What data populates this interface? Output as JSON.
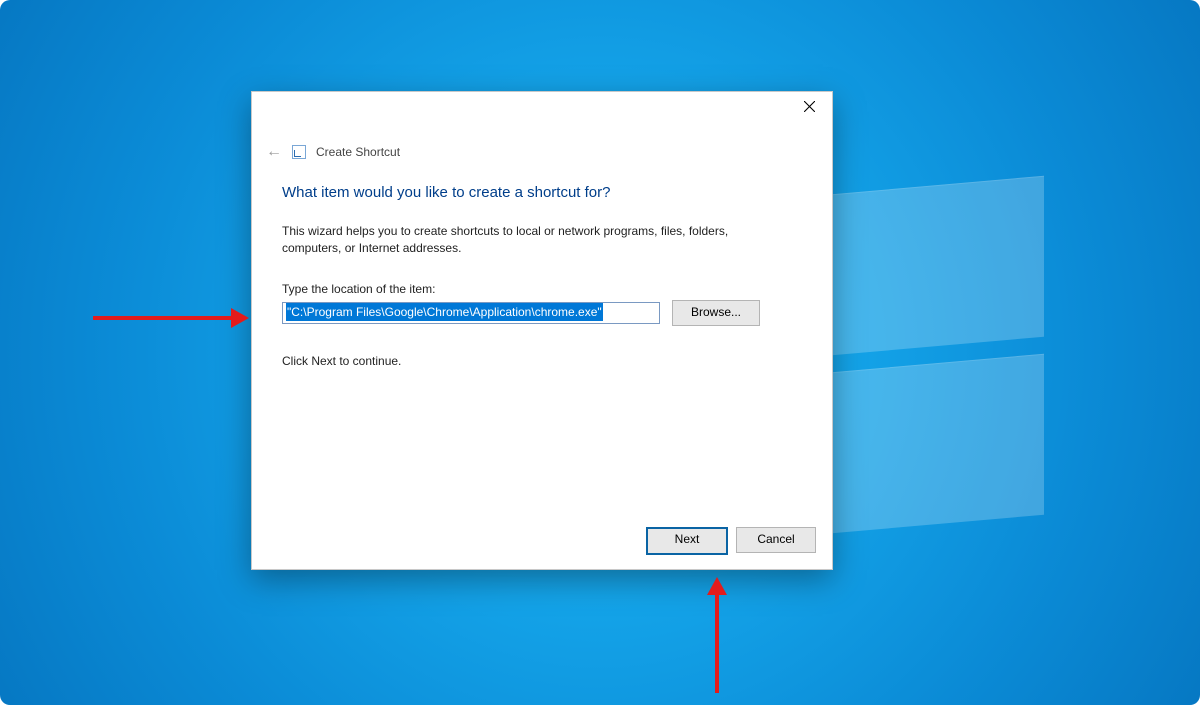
{
  "desktop": {
    "os": "Windows 10"
  },
  "dialog": {
    "title": "Create Shortcut",
    "heading": "What item would you like to create a shortcut for?",
    "description": "This wizard helps you to create shortcuts to local or network programs, files, folders, computers, or Internet addresses.",
    "field_label": "Type the location of the item:",
    "location_value": "\"C:\\Program Files\\Google\\Chrome\\Application\\chrome.exe\"",
    "browse_label": "Browse...",
    "continue_text": "Click Next to continue.",
    "next_label": "Next",
    "cancel_label": "Cancel"
  },
  "annotations": {
    "arrow1_target": "location-input",
    "arrow2_target": "next-button",
    "color": "#e31b1b"
  }
}
